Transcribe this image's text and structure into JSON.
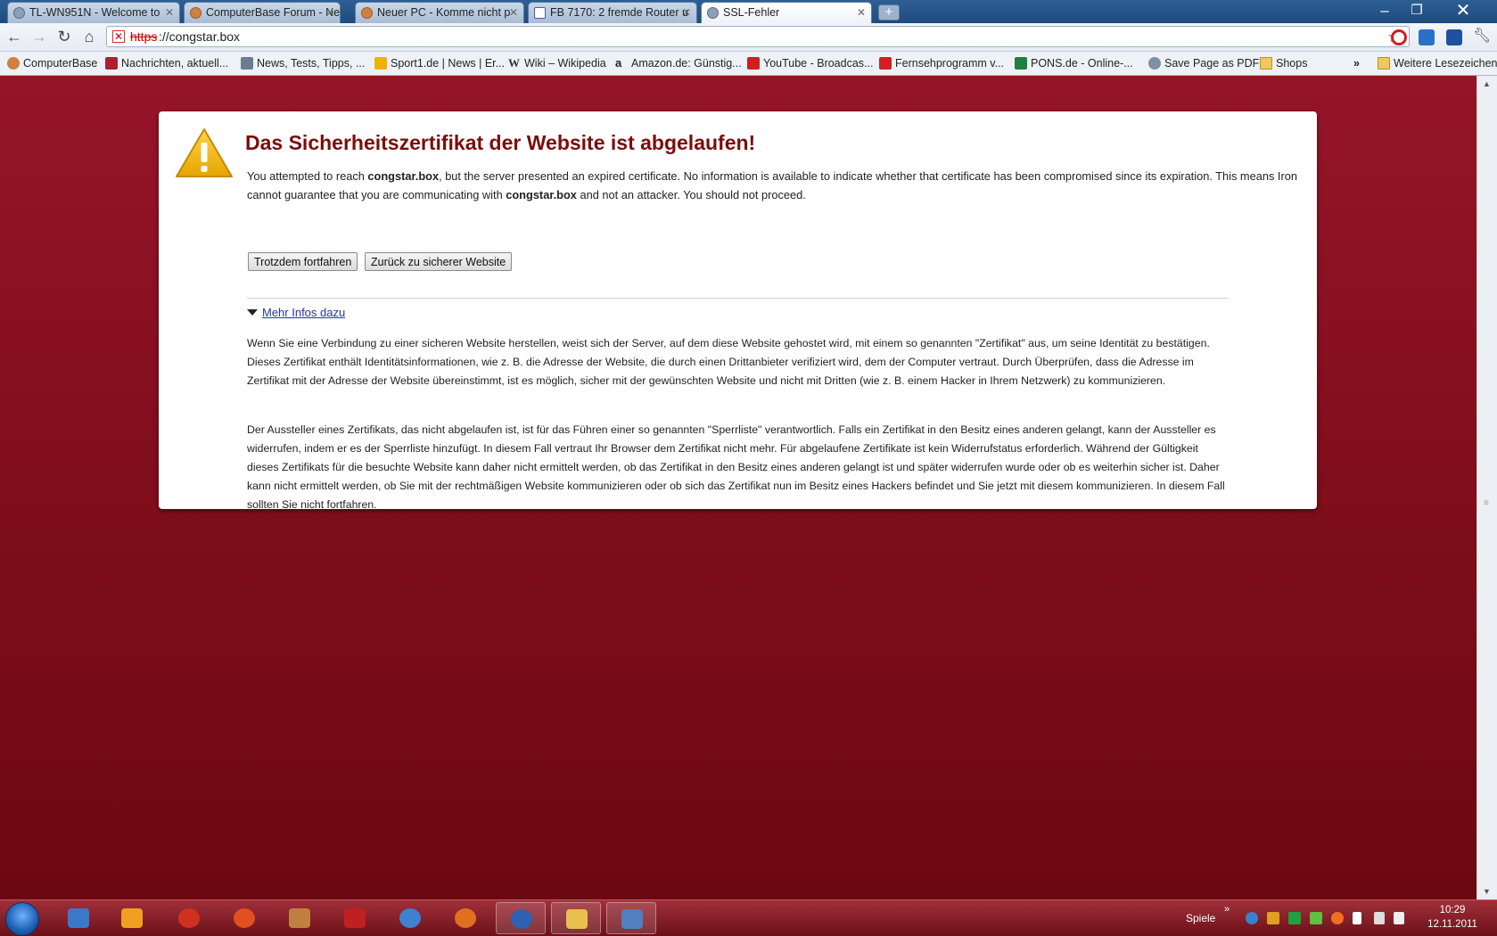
{
  "tabs": [
    {
      "title": "TL-WN951N - Welcome to",
      "icon": "globe-icon"
    },
    {
      "title": "ComputerBase Forum - Neu",
      "icon": "computerbase-icon"
    },
    {
      "title": "Neuer PC - Komme nicht p",
      "icon": "computerbase-icon"
    },
    {
      "title": "FB 7170: 2 fremde Router u",
      "icon": "pdf-icon"
    },
    {
      "title": "SSL-Fehler",
      "icon": "globe-icon"
    }
  ],
  "omnibox": {
    "protocol": "https",
    "separator": "://",
    "host": "congstar.box"
  },
  "bookmarks": [
    {
      "label": "ComputerBase",
      "color": "#d08040"
    },
    {
      "label": "Nachrichten, aktuell...",
      "color": "#b02030"
    },
    {
      "label": "News, Tests, Tipps, ...",
      "color": "#6a7c90"
    },
    {
      "label": "Sport1.de | News | Er...",
      "color": "#f0b000"
    },
    {
      "label": "Wiki – Wikipedia",
      "color": "#444444"
    },
    {
      "label": "Amazon.de: Günstig...",
      "color": "#222222"
    },
    {
      "label": "YouTube - Broadcas...",
      "color": "#cc2020"
    },
    {
      "label": "Fernsehprogramm v...",
      "color": "#d02020"
    },
    {
      "label": "PONS.de - Online-...",
      "color": "#208040"
    },
    {
      "label": "Save Page as PDF",
      "color": "#8090a0"
    },
    {
      "label": "Shops",
      "color": "#f0c860"
    }
  ],
  "bookmarks_overflow": "»",
  "other_bookmarks": "Weitere Lesezeichen",
  "error": {
    "title": "Das Sicherheitszertifikat der Website ist abgelaufen!",
    "intro_1": "You attempted to reach ",
    "host": "congstar.box",
    "intro_2": ", but the server presented an expired certificate. No information is available to indicate whether that certificate has been compromised since its expiration. This means Iron cannot guarantee that you are communicating with ",
    "intro_3": " and not an attacker. You should not proceed.",
    "proceed_button": "Trotzdem fortfahren",
    "back_button": "Zurück zu sicherer Website",
    "more_info_link": "Mehr Infos dazu",
    "paragraph_1": "Wenn Sie eine Verbindung zu einer sicheren Website herstellen, weist sich der Server, auf dem diese Website gehostet wird, mit einem so genannten \"Zertifikat\" aus, um seine Identität zu bestätigen. Dieses Zertifikat enthält Identitätsinformationen, wie z. B. die Adresse der Website, die durch einen Drittanbieter verifiziert wird, dem der Computer vertraut. Durch Überprüfen, dass die Adresse im Zertifikat mit der Adresse der Website übereinstimmt, ist es möglich, sicher mit der gewünschten Website und nicht mit Dritten (wie z. B. einem Hacker in Ihrem Netzwerk) zu kommunizieren.",
    "paragraph_2": "Der Aussteller eines Zertifikats, das nicht abgelaufen ist, ist für das Führen einer so genannten \"Sperrliste\" verantwortlich. Falls ein Zertifikat in den Besitz eines anderen gelangt, kann der Aussteller es widerrufen, indem er es der Sperrliste hinzufügt. In diesem Fall vertraut Ihr Browser dem Zertifikat nicht mehr. Für abgelaufene Zertifikate ist kein Widerrufstatus erforderlich. Während der Gültigkeit dieses Zertifikats für die besuchte Website kann daher nicht ermittelt werden, ob das Zertifikat in den Besitz eines anderen gelangt ist und später widerrufen wurde oder ob es weiterhin sicher ist. Daher kann nicht ermittelt werden, ob Sie mit der rechtmäßigen Website kommunizieren oder ob sich das Zertifikat nun im Besitz eines Hackers befindet und Sie jetzt mit diesem kommunizieren. In diesem Fall sollten Sie nicht fortfahren."
  },
  "taskbar": {
    "apps": [
      {
        "name": "downloads-icon",
        "color": "#3a78c8"
      },
      {
        "name": "media-player-icon",
        "color": "#f0a020"
      },
      {
        "name": "burn-icon",
        "color": "#d03020"
      },
      {
        "name": "paint-icon",
        "color": "#e05020"
      },
      {
        "name": "calendar-icon",
        "color": "#c08040"
      },
      {
        "name": "board-icon",
        "color": "#c02020"
      },
      {
        "name": "messenger-icon",
        "color": "#4080d0"
      },
      {
        "name": "firefox-icon",
        "color": "#e07020"
      },
      {
        "name": "iron-browser-icon",
        "color": "#3060b0"
      },
      {
        "name": "explorer-icon",
        "color": "#e8c050"
      },
      {
        "name": "settings-tool-icon",
        "color": "#5080c0"
      }
    ],
    "toolbar_label": "Spiele",
    "time": "10:29",
    "date": "12.11.2011"
  }
}
